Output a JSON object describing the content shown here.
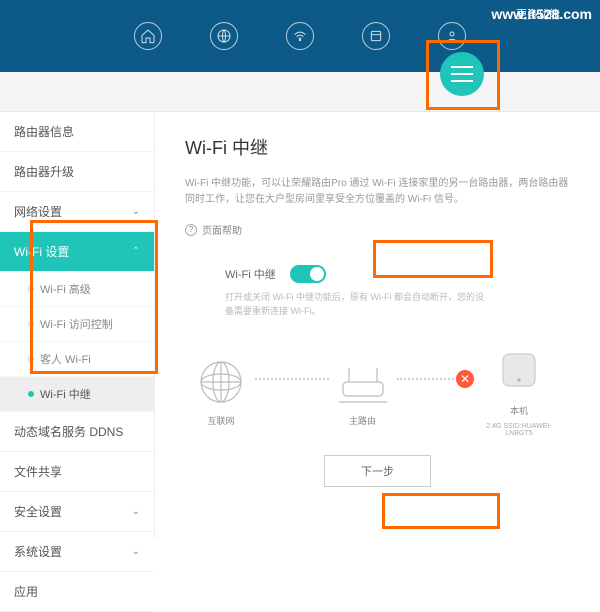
{
  "header": {
    "more_label": "更多功能",
    "watermark": "www.it528.com"
  },
  "sidebar": {
    "items": [
      {
        "label": "路由器信息"
      },
      {
        "label": "路由器升级"
      },
      {
        "label": "网络设置"
      },
      {
        "label": "Wi-Fi 设置"
      },
      {
        "label": "动态域名服务 DDNS"
      },
      {
        "label": "文件共享"
      },
      {
        "label": "安全设置"
      },
      {
        "label": "系统设置"
      },
      {
        "label": "应用"
      }
    ],
    "wifi_subitems": [
      {
        "label": "Wi-Fi 高级"
      },
      {
        "label": "Wi-Fi 访问控制"
      },
      {
        "label": "客人 Wi-Fi"
      },
      {
        "label": "Wi-Fi 中继"
      }
    ]
  },
  "main": {
    "title": "Wi-Fi 中继",
    "description": "Wi-Fi 中继功能，可以让荣耀路由Pro 通过 Wi-Fi 连接家里的另一台路由器，两台路由器同时工作，让您在大户型房间里享受全方位覆盖的 Wi-Fi 信号。",
    "page_help": "页面帮助",
    "toggle_label": "Wi-Fi 中继",
    "toggle_desc": "打开或关闭 Wi-Fi 中继功能后，原有 Wi-Fi 都会自动断开，您的设备需要重新连接 Wi-Fi。",
    "diagram": {
      "internet": "互联网",
      "main_router": "主路由",
      "this_device": "本机",
      "this_device_sub": "2.4G SSID:HUAWEI-LNBGT5"
    },
    "next_button": "下一步"
  }
}
